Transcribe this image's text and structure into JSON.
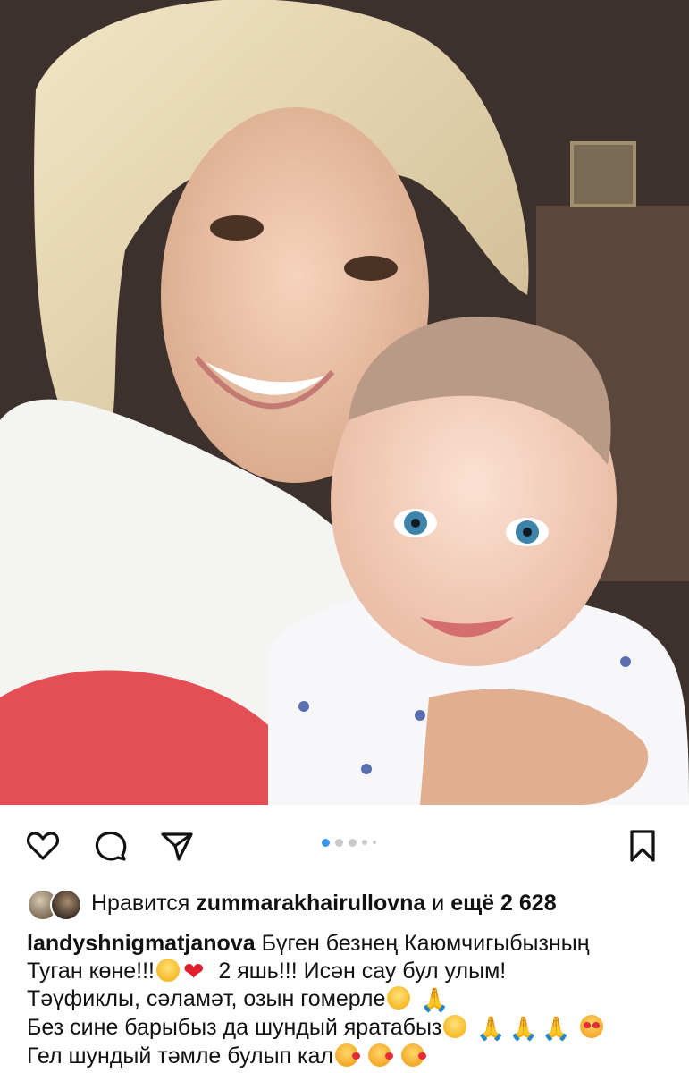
{
  "post": {
    "photo_alt": "",
    "likes": {
      "prefix": "Нравится",
      "user": "zummarakhairullovna",
      "middle": "и",
      "others": "ещё 2 628"
    },
    "caption": {
      "author": "landyshnigmatjanova",
      "line1": "Бүген безнең Каюмчигыбызның",
      "line2a": "Туган көне!!!",
      "line2b": "2 яшь!!! Исән сау бул улым!",
      "line3": "Тәүфиклы, сәламәт, озын гомерле",
      "line4": "Без сине барыбыз да шундый яратабыз",
      "line5": "Гел шундый тәмле булып кал"
    },
    "icons": [
      "heart-icon",
      "comment-icon",
      "share-icon",
      "bookmark-icon"
    ],
    "carousel": {
      "total": 5,
      "active": 1
    },
    "colors": {
      "accent": "#3897f0",
      "text": "#111111"
    }
  }
}
